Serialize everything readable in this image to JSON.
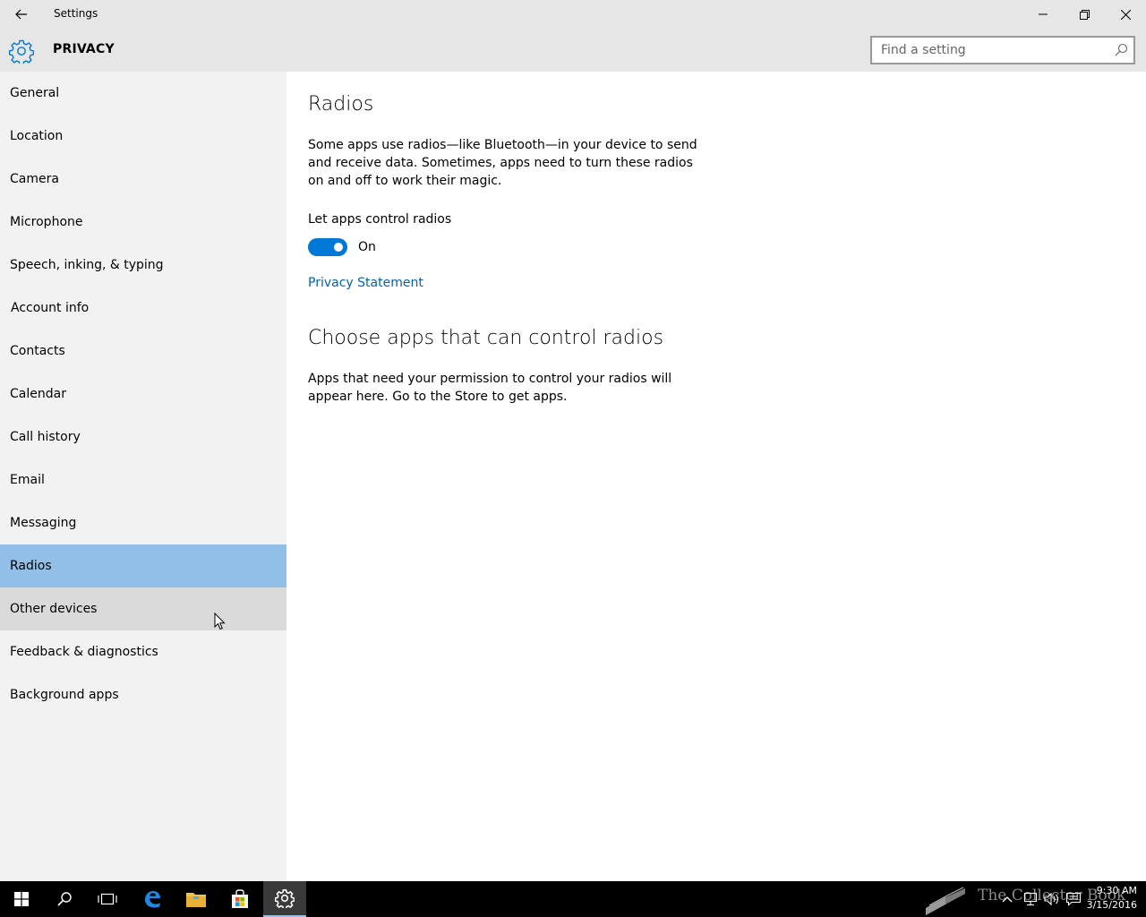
{
  "window": {
    "title": "Settings"
  },
  "header": {
    "section_title": "PRIVACY",
    "search_placeholder": "Find a setting"
  },
  "sidebar": {
    "items": [
      {
        "label": "General"
      },
      {
        "label": "Location"
      },
      {
        "label": "Camera"
      },
      {
        "label": "Microphone"
      },
      {
        "label": "Speech, inking, & typing"
      },
      {
        "label": "Account info"
      },
      {
        "label": "Contacts"
      },
      {
        "label": "Calendar"
      },
      {
        "label": "Call history"
      },
      {
        "label": "Email"
      },
      {
        "label": "Messaging"
      },
      {
        "label": "Radios"
      },
      {
        "label": "Other devices"
      },
      {
        "label": "Feedback & diagnostics"
      },
      {
        "label": "Background apps"
      }
    ],
    "selected": "Radios",
    "hovered": "Other devices"
  },
  "main": {
    "title": "Radios",
    "description": "Some apps use radios—like Bluetooth—in your device to send and receive data. Sometimes, apps need to turn these radios on and off to work their magic.",
    "toggle_label": "Let apps control radios",
    "toggle_state": "On",
    "privacy_link": "Privacy Statement",
    "section2_title": "Choose apps that can control radios",
    "section2_description": "Apps that need your permission to control your radios will appear here. Go to the Store to get apps."
  },
  "taskbar": {
    "watermark": "The Collector Book",
    "time": "9:30 AM",
    "date": "3/15/2016"
  },
  "colors": {
    "accent": "#0078d7",
    "selected_nav": "#91bfe8",
    "link": "#0063b1"
  }
}
